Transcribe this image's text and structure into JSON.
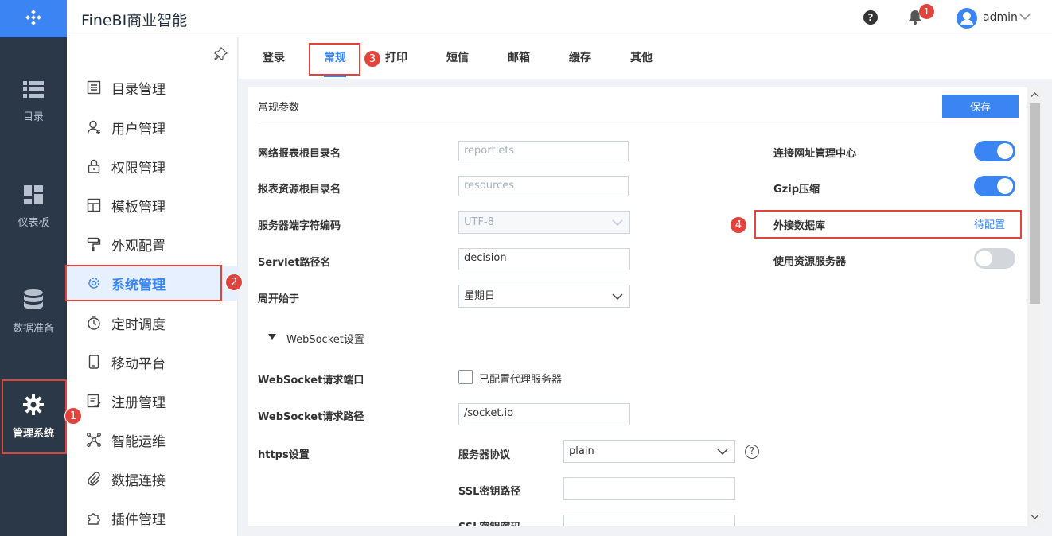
{
  "app": {
    "title": "FineBI商业智能"
  },
  "header": {
    "help_icon": "?",
    "notification_count": "1",
    "username": "admin"
  },
  "rail": {
    "items": [
      {
        "label": "目录",
        "icon": "list-icon"
      },
      {
        "label": "仪表板",
        "icon": "dashboard-icon"
      },
      {
        "label": "数据准备",
        "icon": "database-icon"
      },
      {
        "label": "管理系统",
        "icon": "gear-icon",
        "active": true
      }
    ]
  },
  "sidebar": {
    "items": [
      {
        "label": "目录管理"
      },
      {
        "label": "用户管理"
      },
      {
        "label": "权限管理"
      },
      {
        "label": "模板管理"
      },
      {
        "label": "外观配置"
      },
      {
        "label": "系统管理",
        "active": true
      },
      {
        "label": "定时调度"
      },
      {
        "label": "移动平台"
      },
      {
        "label": "注册管理"
      },
      {
        "label": "智能运维"
      },
      {
        "label": "数据连接"
      },
      {
        "label": "插件管理"
      }
    ]
  },
  "tabs": [
    {
      "label": "登录"
    },
    {
      "label": "常规",
      "active": true
    },
    {
      "label": "打印"
    },
    {
      "label": "短信"
    },
    {
      "label": "邮箱"
    },
    {
      "label": "缓存"
    },
    {
      "label": "其他"
    }
  ],
  "panel": {
    "title": "常规参数",
    "save_label": "保存",
    "fields": {
      "report_root": {
        "label": "网络报表根目录名",
        "value": "reportlets"
      },
      "resource_root": {
        "label": "报表资源根目录名",
        "value": "resources"
      },
      "server_encoding": {
        "label": "服务器端字符编码",
        "value": "UTF-8"
      },
      "servlet_path": {
        "label": "Servlet路径名",
        "value": "decision"
      },
      "week_start": {
        "label": "周开始于",
        "value": "星期日"
      }
    },
    "right": {
      "url_center": {
        "label": "连接网址管理中心",
        "on": true
      },
      "gzip": {
        "label": "Gzip压缩",
        "on": true
      },
      "external_db": {
        "label": "外接数据库",
        "link": "待配置"
      },
      "resource_server": {
        "label": "使用资源服务器",
        "on": false
      }
    },
    "websocket": {
      "section_title": "WebSocket设置",
      "port_label": "WebSocket请求端口",
      "proxy_label": "已配置代理服务器",
      "path_label": "WebSocket请求路径",
      "path_value": "/socket.io"
    },
    "https": {
      "label": "https设置",
      "protocol_label": "服务器协议",
      "protocol_value": "plain",
      "ssl_key_path_label": "SSL密钥路径",
      "ssl_key_password_label": "SSL密钥密码"
    }
  },
  "annotations": [
    "1",
    "2",
    "3",
    "4"
  ],
  "colors": {
    "accent": "#3a85f3",
    "rail": "#2a3847",
    "annotation": "#e0443d"
  }
}
